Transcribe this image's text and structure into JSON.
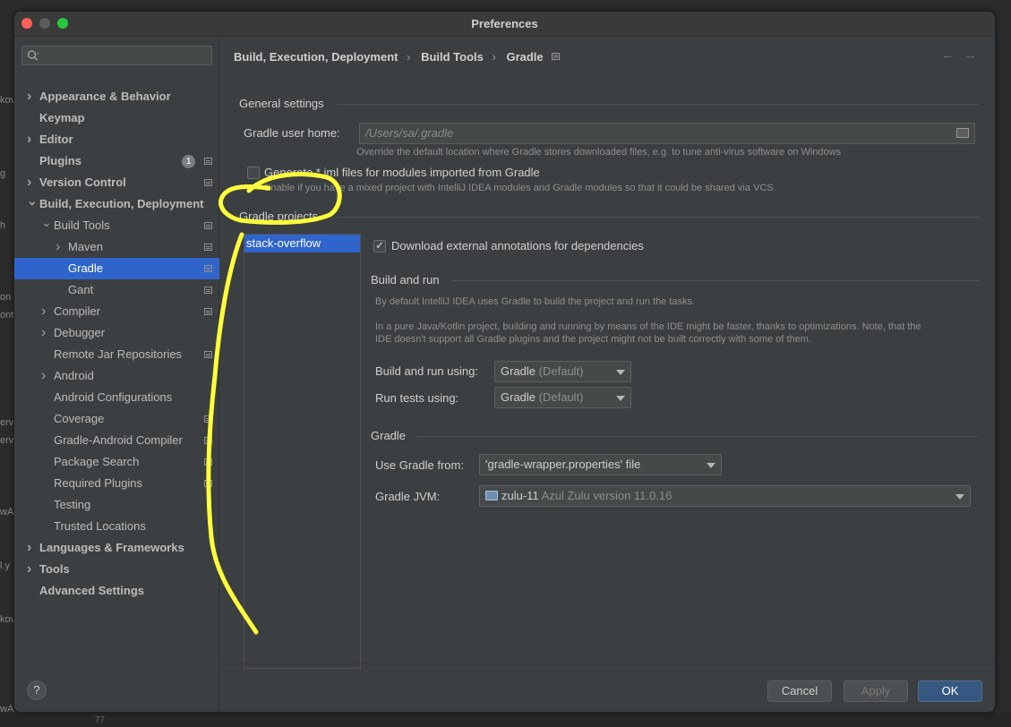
{
  "window": {
    "title": "Preferences"
  },
  "search": {
    "placeholder": ""
  },
  "sidebar": {
    "items": [
      {
        "label": "Appearance & Behavior",
        "level": 0,
        "arrow": "right",
        "bold": true
      },
      {
        "label": "Keymap",
        "level": 0,
        "arrow": "",
        "bold": true
      },
      {
        "label": "Editor",
        "level": 0,
        "arrow": "right",
        "bold": true
      },
      {
        "label": "Plugins",
        "level": 0,
        "arrow": "",
        "bold": true,
        "badge": "1",
        "icon": true
      },
      {
        "label": "Version Control",
        "level": 0,
        "arrow": "right",
        "bold": true,
        "icon": true
      },
      {
        "label": "Build, Execution, Deployment",
        "level": 0,
        "arrow": "down",
        "bold": true
      },
      {
        "label": "Build Tools",
        "level": 1,
        "arrow": "down",
        "icon": true
      },
      {
        "label": "Maven",
        "level": 2,
        "arrow": "right",
        "icon": true
      },
      {
        "label": "Gradle",
        "level": 2,
        "arrow": "",
        "selected": true,
        "icon": true
      },
      {
        "label": "Gant",
        "level": 2,
        "arrow": "",
        "icon": true
      },
      {
        "label": "Compiler",
        "level": 1,
        "arrow": "right",
        "icon": true
      },
      {
        "label": "Debugger",
        "level": 1,
        "arrow": "right"
      },
      {
        "label": "Remote Jar Repositories",
        "level": 1,
        "arrow": "",
        "icon": true
      },
      {
        "label": "Android",
        "level": 1,
        "arrow": "right"
      },
      {
        "label": "Android Configurations",
        "level": 1,
        "arrow": ""
      },
      {
        "label": "Coverage",
        "level": 1,
        "arrow": "",
        "icon": true
      },
      {
        "label": "Gradle-Android Compiler",
        "level": 1,
        "arrow": "",
        "icon": true
      },
      {
        "label": "Package Search",
        "level": 1,
        "arrow": "",
        "icon": true
      },
      {
        "label": "Required Plugins",
        "level": 1,
        "arrow": "",
        "icon": true
      },
      {
        "label": "Testing",
        "level": 1,
        "arrow": ""
      },
      {
        "label": "Trusted Locations",
        "level": 1,
        "arrow": ""
      },
      {
        "label": "Languages & Frameworks",
        "level": 0,
        "arrow": "right",
        "bold": true
      },
      {
        "label": "Tools",
        "level": 0,
        "arrow": "right",
        "bold": true
      },
      {
        "label": "Advanced Settings",
        "level": 0,
        "arrow": "",
        "bold": true
      }
    ]
  },
  "breadcrumb": {
    "part1": "Build, Execution, Deployment",
    "part2": "Build Tools",
    "part3": "Gradle",
    "sep": "›"
  },
  "nav": {
    "back": "←",
    "forward": "→"
  },
  "general": {
    "title": "General settings",
    "home_label": "Gradle user home:",
    "home_value": "/Users/sa/.gradle",
    "home_hint": "Override the default location where Gradle stores downloaded files, e.g. to tune anti-virus software on Windows",
    "iml_label": "Generate *.iml files for modules imported from Gradle",
    "iml_hint": "Enable if you have a mixed project with IntelliJ IDEA modules and Gradle modules so that it could be shared via VCS",
    "iml_checked": false
  },
  "projects": {
    "title": "Gradle projects",
    "list": [
      "stack-overflow"
    ],
    "download_label": "Download external annotations for dependencies",
    "download_checked": true
  },
  "build_run": {
    "title": "Build and run",
    "desc1": "By default IntelliJ IDEA uses Gradle to build the project and run the tasks.",
    "desc2": "In a pure Java/Kotlin project, building and running by means of the IDE might be faster, thanks to optimizations. Note, that the",
    "desc3": "IDE doesn't support all Gradle plugins and the project might not be built correctly with some of them.",
    "using_label": "Build and run using:",
    "using_value": "Gradle",
    "using_dim": "(Default)",
    "tests_label": "Run tests using:",
    "tests_value": "Gradle",
    "tests_dim": "(Default)"
  },
  "gradle": {
    "title": "Gradle",
    "from_label": "Use Gradle from:",
    "from_value": "'gradle-wrapper.properties' file",
    "jvm_label": "Gradle JVM:",
    "jvm_value": "zulu-11",
    "jvm_dim": "Azul Zulu version 11.0.16"
  },
  "footer": {
    "help": "?",
    "cancel": "Cancel",
    "apply": "Apply",
    "ok": "OK"
  },
  "background": {
    "fragments": [
      "kov",
      "g",
      "h",
      "on",
      "ont",
      "erv",
      "erv",
      "wA",
      "l.y",
      "kov",
      "wA"
    ],
    "line_no": "77"
  },
  "colors": {
    "selection": "#2f65ca",
    "annotation": "#ffff3a",
    "primary_button": "#365880"
  }
}
